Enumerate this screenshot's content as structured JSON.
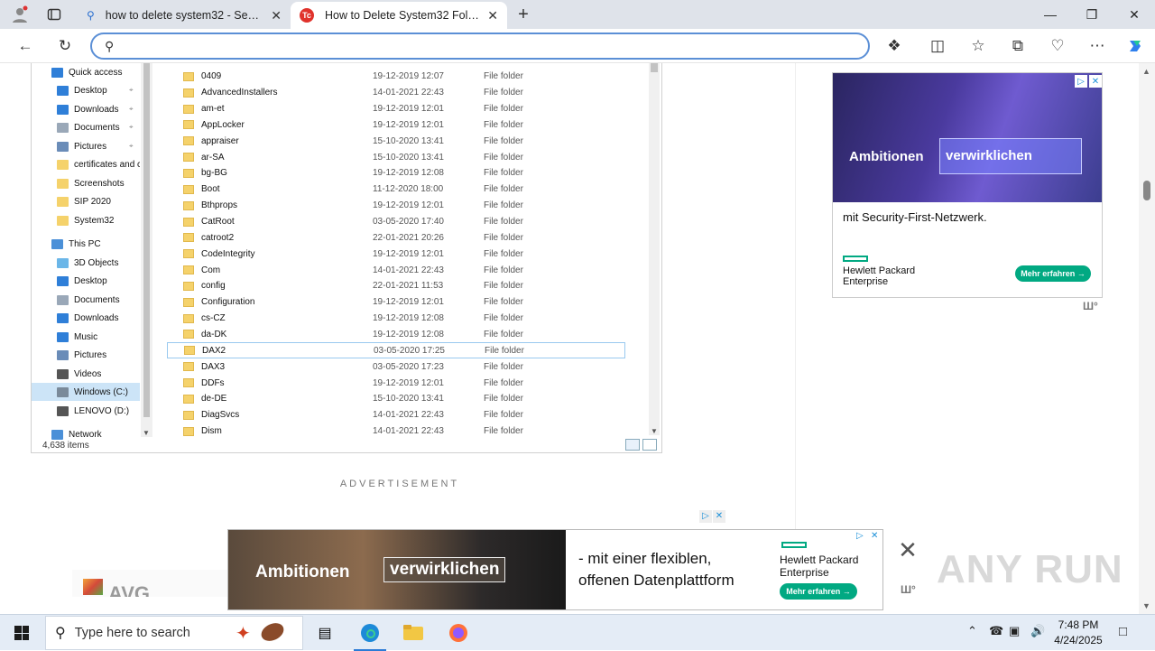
{
  "tabs": [
    {
      "title": "how to delete system32 - Search",
      "active": false
    },
    {
      "title": "How to Delete System32 Folder in",
      "active": true
    }
  ],
  "address": {
    "value": "",
    "placeholder": ""
  },
  "explorer": {
    "nav_items": [
      {
        "label": "Quick access",
        "icon": "star-icon",
        "pinned": false,
        "selected": false,
        "indent": 1,
        "color": "#2f7fd8"
      },
      {
        "label": "Desktop",
        "icon": "desktop-icon",
        "pinned": true,
        "selected": false,
        "indent": 2,
        "color": "#2f7fd8"
      },
      {
        "label": "Downloads",
        "icon": "download-icon",
        "pinned": true,
        "selected": false,
        "indent": 2,
        "color": "#2f7fd8"
      },
      {
        "label": "Documents",
        "icon": "document-icon",
        "pinned": true,
        "selected": false,
        "indent": 2,
        "color": "#9aa8b8"
      },
      {
        "label": "Pictures",
        "icon": "pictures-icon",
        "pinned": true,
        "selected": false,
        "indent": 2,
        "color": "#6a8cb8"
      },
      {
        "label": "certificates and c",
        "icon": "folder-icon",
        "pinned": false,
        "selected": false,
        "indent": 2,
        "color": "#f5d26b"
      },
      {
        "label": "Screenshots",
        "icon": "folder-icon",
        "pinned": false,
        "selected": false,
        "indent": 2,
        "color": "#f5d26b"
      },
      {
        "label": "SIP 2020",
        "icon": "folder-icon",
        "pinned": false,
        "selected": false,
        "indent": 2,
        "color": "#f5d26b"
      },
      {
        "label": "System32",
        "icon": "folder-icon",
        "pinned": false,
        "selected": false,
        "indent": 2,
        "color": "#f5d26b"
      },
      {
        "label": "This PC",
        "icon": "pc-icon",
        "pinned": false,
        "selected": false,
        "indent": 1,
        "color": "#4b90d8"
      },
      {
        "label": "3D Objects",
        "icon": "cube-icon",
        "pinned": false,
        "selected": false,
        "indent": 2,
        "color": "#6bb6e8"
      },
      {
        "label": "Desktop",
        "icon": "desktop-icon",
        "pinned": false,
        "selected": false,
        "indent": 2,
        "color": "#2f7fd8"
      },
      {
        "label": "Documents",
        "icon": "document-icon",
        "pinned": false,
        "selected": false,
        "indent": 2,
        "color": "#9aa8b8"
      },
      {
        "label": "Downloads",
        "icon": "download-icon",
        "pinned": false,
        "selected": false,
        "indent": 2,
        "color": "#2f7fd8"
      },
      {
        "label": "Music",
        "icon": "music-icon",
        "pinned": false,
        "selected": false,
        "indent": 2,
        "color": "#2f7fd8"
      },
      {
        "label": "Pictures",
        "icon": "pictures-icon",
        "pinned": false,
        "selected": false,
        "indent": 2,
        "color": "#6a8cb8"
      },
      {
        "label": "Videos",
        "icon": "video-icon",
        "pinned": false,
        "selected": false,
        "indent": 2,
        "color": "#555"
      },
      {
        "label": "Windows (C:)",
        "icon": "drive-icon",
        "pinned": false,
        "selected": true,
        "indent": 2,
        "color": "#7a8a9a"
      },
      {
        "label": "LENOVO (D:)",
        "icon": "drive-icon",
        "pinned": false,
        "selected": false,
        "indent": 2,
        "color": "#555"
      },
      {
        "label": "Network",
        "icon": "network-icon",
        "pinned": false,
        "selected": false,
        "indent": 1,
        "color": "#4b90d8"
      }
    ],
    "files": [
      {
        "name": "0409",
        "date": "19-12-2019 12:07",
        "type": "File folder"
      },
      {
        "name": "AdvancedInstallers",
        "date": "14-01-2021 22:43",
        "type": "File folder"
      },
      {
        "name": "am-et",
        "date": "19-12-2019 12:01",
        "type": "File folder"
      },
      {
        "name": "AppLocker",
        "date": "19-12-2019 12:01",
        "type": "File folder"
      },
      {
        "name": "appraiser",
        "date": "15-10-2020 13:41",
        "type": "File folder"
      },
      {
        "name": "ar-SA",
        "date": "15-10-2020 13:41",
        "type": "File folder"
      },
      {
        "name": "bg-BG",
        "date": "19-12-2019 12:08",
        "type": "File folder"
      },
      {
        "name": "Boot",
        "date": "11-12-2020 18:00",
        "type": "File folder"
      },
      {
        "name": "Bthprops",
        "date": "19-12-2019 12:01",
        "type": "File folder"
      },
      {
        "name": "CatRoot",
        "date": "03-05-2020 17:40",
        "type": "File folder"
      },
      {
        "name": "catroot2",
        "date": "22-01-2021 20:26",
        "type": "File folder"
      },
      {
        "name": "CodeIntegrity",
        "date": "19-12-2019 12:01",
        "type": "File folder"
      },
      {
        "name": "Com",
        "date": "14-01-2021 22:43",
        "type": "File folder"
      },
      {
        "name": "config",
        "date": "22-01-2021 11:53",
        "type": "File folder"
      },
      {
        "name": "Configuration",
        "date": "19-12-2019 12:01",
        "type": "File folder"
      },
      {
        "name": "cs-CZ",
        "date": "19-12-2019 12:08",
        "type": "File folder"
      },
      {
        "name": "da-DK",
        "date": "19-12-2019 12:08",
        "type": "File folder"
      },
      {
        "name": "DAX2",
        "date": "03-05-2020 17:25",
        "type": "File folder",
        "focused": true
      },
      {
        "name": "DAX3",
        "date": "03-05-2020 17:23",
        "type": "File folder"
      },
      {
        "name": "DDFs",
        "date": "19-12-2019 12:01",
        "type": "File folder"
      },
      {
        "name": "de-DE",
        "date": "15-10-2020 13:41",
        "type": "File folder"
      },
      {
        "name": "DiagSvcs",
        "date": "14-01-2021 22:43",
        "type": "File folder"
      },
      {
        "name": "Dism",
        "date": "14-01-2021 22:43",
        "type": "File folder"
      }
    ],
    "status": "4,638 items"
  },
  "ad_label": "ADVERTISEMENT",
  "side_ad": {
    "word1": "Ambitionen",
    "word2": "verwirklichen",
    "line": "mit Security-First-Netzwerk.",
    "brand_line1": "Hewlett Packard",
    "brand_line2": "Enterprise",
    "cta": "Mehr erfahren →",
    "ad_choice": "▷",
    "close": "✕",
    "mark": "Ш°"
  },
  "avg_ad": {
    "text": "AVG"
  },
  "bottom_ad": {
    "word1": "Ambitionen",
    "word2": "verwirklichen",
    "line1": "- mit einer flexiblen,",
    "line2": "offenen Datenplattform",
    "brand_line1": "Hewlett Packard",
    "brand_line2": "Enterprise",
    "cta": "Mehr erfahren →",
    "close": "✕"
  },
  "watermark": "ANY RUN",
  "taskbar": {
    "search_placeholder": "Type here to search",
    "time": "7:48 PM",
    "date": "4/24/2025"
  }
}
